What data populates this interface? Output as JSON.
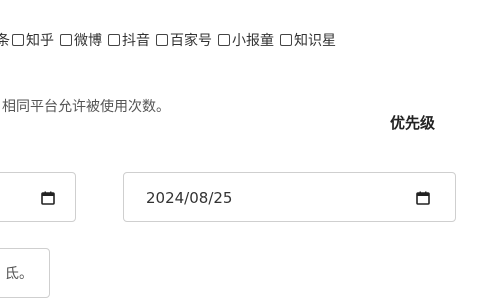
{
  "platforms": {
    "first_label": "条",
    "items": [
      {
        "label": "知乎",
        "checked": false
      },
      {
        "label": "微博",
        "checked": false
      },
      {
        "label": "抖音",
        "checked": false
      },
      {
        "label": "百家号",
        "checked": false
      },
      {
        "label": "小报童",
        "checked": false
      },
      {
        "label": "知识星",
        "checked": false
      }
    ]
  },
  "hint": "相同平台允许被使用次数。",
  "priority_label": "优先级",
  "dates": {
    "start": "",
    "end": "2024/08/25"
  },
  "bottom_input": {
    "text": "氐。"
  }
}
